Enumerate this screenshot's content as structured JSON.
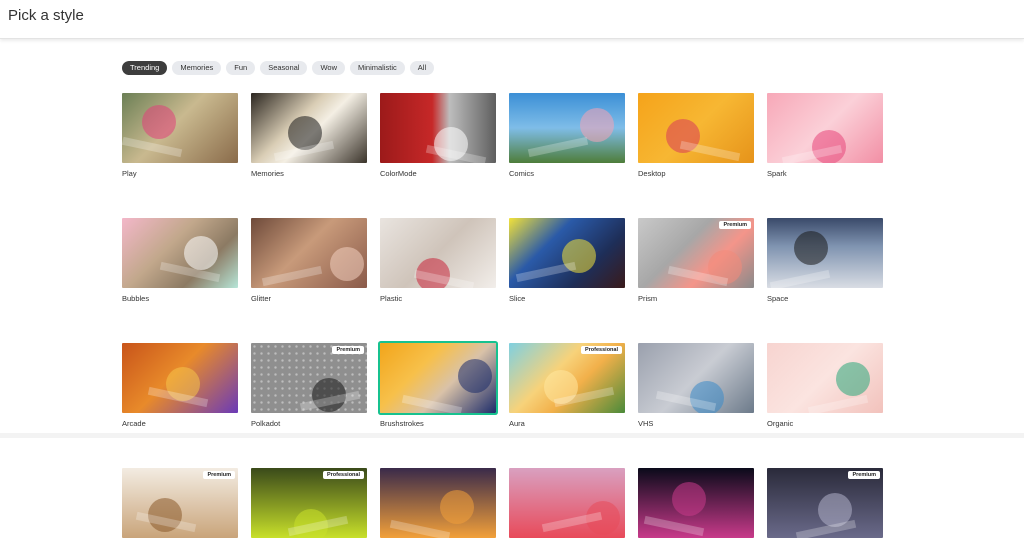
{
  "header": {
    "title": "Pick a style"
  },
  "filters": [
    "Trending",
    "Memories",
    "Fun",
    "Seasonal",
    "Wow",
    "Minimalistic",
    "All"
  ],
  "active_filter": "Trending",
  "styles": [
    {
      "label": "Play",
      "badge": "",
      "bg": "linear-gradient(135deg,#6b7f55 0%,#c9b98f 45%,#8a6b4a 100%)",
      "accent": "#e0407a"
    },
    {
      "label": "Memories",
      "badge": "",
      "bg": "linear-gradient(135deg,#2b2620 0%,#d9cdb5 40%,#f4efe4 55%,#3a332a 100%)",
      "accent": "#1a1a1a"
    },
    {
      "label": "ColorMode",
      "badge": "",
      "bg": "linear-gradient(90deg,#9c1a1a 0%,#c62828 45%,#bdbdbd 60%,#5e5e5e 100%)",
      "accent": "#ffffff"
    },
    {
      "label": "Comics",
      "badge": "",
      "bg": "linear-gradient(180deg,#3b8fd6 0%,#7fbde8 50%,#4e7d3a 100%)",
      "accent": "#f5a3b5"
    },
    {
      "label": "Desktop",
      "badge": "",
      "bg": "linear-gradient(135deg,#f5a31a 0%,#f7b733 50%,#e6931a 100%)",
      "accent": "#d83a5a"
    },
    {
      "label": "Spark",
      "badge": "",
      "bg": "linear-gradient(135deg,#f7a8b8 0%,#fbd0d8 50%,#f28fa5 100%)",
      "accent": "#e8457a"
    },
    {
      "label": "Bubbles",
      "badge": "",
      "bg": "linear-gradient(135deg,#f3b7c9 0%,#c2a88c 40%,#8c7a63 70%,#b6e6d8 100%)",
      "accent": "#ffffff"
    },
    {
      "label": "Glitter",
      "badge": "",
      "bg": "linear-gradient(135deg,#6e4a3a 0%,#c89a7a 45%,#8a5a4a 100%)",
      "accent": "#f2d0c0"
    },
    {
      "label": "Plastic",
      "badge": "",
      "bg": "linear-gradient(135deg,#e9e4df 0%,#cfc4ba 50%,#f2eeea 100%)",
      "accent": "#c8253a"
    },
    {
      "label": "Slice",
      "badge": "",
      "bg": "linear-gradient(135deg,#f2e23a 0%,#2a5aa8 35%,#1e2e58 70%,#3a1a1a 100%)",
      "accent": "#f2e23a"
    },
    {
      "label": "Prism",
      "badge": "Premium",
      "bg": "linear-gradient(135deg,#c9c9c9 0%,#a7a7a7 40%,#f4958a 65%,#8a8a8a 100%)",
      "accent": "#f28a7a"
    },
    {
      "label": "Space",
      "badge": "",
      "bg": "linear-gradient(180deg,#3a4a6a 0%,#7f93b0 40%,#d9dde4 100%)",
      "accent": "#1a1a1a"
    },
    {
      "label": "Arcade",
      "badge": "",
      "bg": "linear-gradient(135deg,#c8541a 0%,#e88a2a 45%,#6a3ab8 100%)",
      "accent": "#f5c44a"
    },
    {
      "label": "Polkadot",
      "badge": "Premium",
      "bg": "radial-gradient(circle,#bdbdbd 1.2px,#8f8f8f 1.3px) 0 0/7px 7px",
      "accent": "#1a1a1a"
    },
    {
      "label": "Brushstrokes",
      "badge": "",
      "bg": "linear-gradient(135deg,#f2a51a 0%,#f7c04a 35%,#d9c2a8 60%,#1c2c6a 100%)",
      "accent": "#1c2c6a"
    },
    {
      "label": "Aura",
      "badge": "Professional",
      "bg": "linear-gradient(135deg,#7fd0e0 0%,#f7d27a 40%,#f2b04a 60%,#4a8a3a 100%)",
      "accent": "#ffe7a0"
    },
    {
      "label": "VHS",
      "badge": "",
      "bg": "linear-gradient(135deg,#9aa0ad 0%,#c9ccd3 50%,#6c7a8a 100%)",
      "accent": "#3a8ac8"
    },
    {
      "label": "Organic",
      "badge": "",
      "bg": "linear-gradient(135deg,#f7d4d0 0%,#fbe4e0 50%,#f2c2bc 100%)",
      "accent": "#2aa87a"
    },
    {
      "label": "",
      "badge": "Premium",
      "bg": "linear-gradient(180deg,#f3ece2 0%,#c9a47a 100%)",
      "accent": "#8a5a2a"
    },
    {
      "label": "",
      "badge": "Professional",
      "bg": "linear-gradient(180deg,#3a4a1a 0%,#c8e02a 100%)",
      "accent": "#c8e02a"
    },
    {
      "label": "",
      "badge": "",
      "bg": "linear-gradient(180deg,#3a2a4a 0%,#f2a03a 100%)",
      "accent": "#f2a03a"
    },
    {
      "label": "",
      "badge": "",
      "bg": "linear-gradient(180deg,#d9a0c0 0%,#e84a5a 100%)",
      "accent": "#e84a5a"
    },
    {
      "label": "",
      "badge": "",
      "bg": "linear-gradient(180deg,#0a0a1a 0%,#c83a8a 100%)",
      "accent": "#c83a8a"
    },
    {
      "label": "",
      "badge": "Premium",
      "bg": "linear-gradient(180deg,#2a2a3a 0%,#6a6a8a 100%)",
      "accent": "#b0b0c8"
    }
  ],
  "selected_style": "Brushstrokes"
}
